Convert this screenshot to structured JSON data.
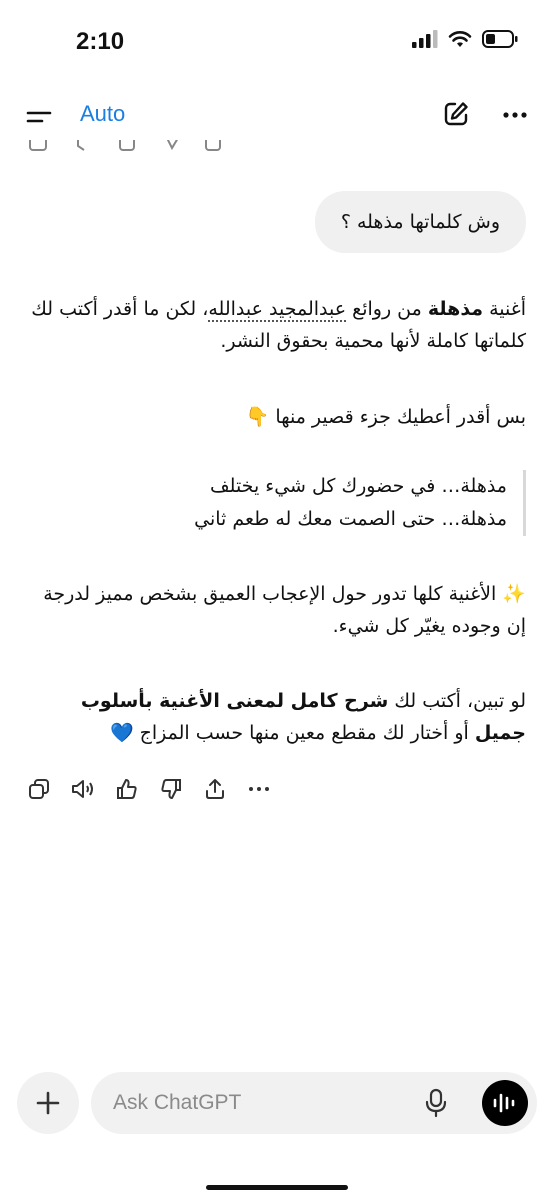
{
  "status_bar": {
    "time": "2:10"
  },
  "nav": {
    "model": "Auto"
  },
  "user_message": "وش كلماتها مذهله ؟",
  "reply": {
    "p1_a": "أغنية ",
    "p1_bold": "مذهلة",
    "p1_b": " من روائع ",
    "p1_link": "عبدالمجيد عبدالله",
    "p1_c": "، لكن ما أقدر أكتب لك كلماتها كاملة لأنها محمية بحقوق النشر.",
    "p2": "بس أقدر أعطيك جزء قصير منها 👇",
    "quote_line1": "مذهلة… في حضورك كل شيء يختلف",
    "quote_line2": "مذهلة… حتى الصمت معك له طعم ثاني",
    "p3": "✨ الأغنية كلها تدور حول الإعجاب العميق بشخص مميز لدرجة إن وجوده يغيّر كل شيء.",
    "p4_a": "لو تبين، أكتب لك ",
    "p4_bold": "شرح كامل لمعنى الأغنية بأسلوب جميل",
    "p4_b": " أو أختار لك مقطع معين منها حسب المزاج 💙"
  },
  "actions": [
    "copy-icon",
    "speaker-icon",
    "thumbs-up-icon",
    "thumbs-down-icon",
    "share-icon",
    "more-icon"
  ],
  "composer": {
    "placeholder": "Ask ChatGPT"
  },
  "colors": {
    "accent": "#1a7fe0",
    "bubble": "#f0f0f0"
  }
}
